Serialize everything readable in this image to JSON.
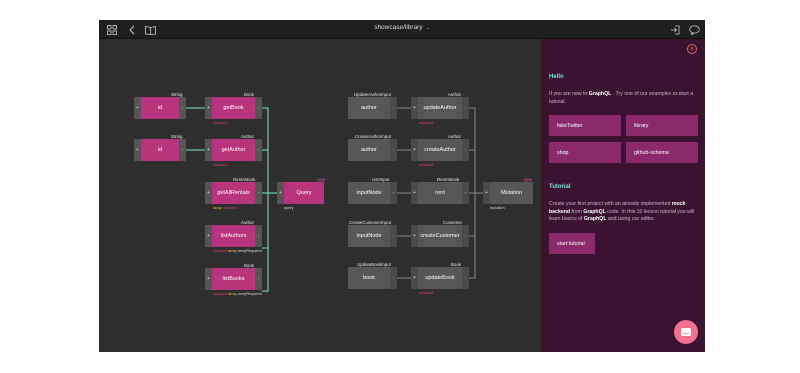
{
  "window": {
    "title": "showcase/library"
  },
  "toolbar": {
    "icons": [
      "grid-icon",
      "back-icon",
      "book-icon",
      "logout-icon",
      "chat-bubble-icon"
    ]
  },
  "graph": {
    "nodes": {
      "id1": {
        "label": "id",
        "type": "String"
      },
      "id2": {
        "label": "id",
        "type": "String"
      },
      "getBook": {
        "label": "getBook",
        "type": "Book",
        "sub": "required"
      },
      "getAuthor": {
        "label": "getAuthor",
        "type": "Author",
        "sub": "required"
      },
      "getAllRentals": {
        "label": "getAllRentals",
        "type": "RentABook",
        "sub_array": "array",
        "sub_required": "required"
      },
      "listAuthors": {
        "label": "listAuthors",
        "type": "Author",
        "sub_required": "required",
        "sub_array": "array",
        "sub_array_required": "arrayRequired"
      },
      "listBooks": {
        "label": "listBooks",
        "type": "Book",
        "sub_required": "required",
        "sub_array": "array",
        "sub_array_required": "arrayRequired"
      },
      "query": {
        "label": "Query",
        "type": "type",
        "sub": "query"
      },
      "author1": {
        "label": "author",
        "type": "UpdateAuthorInput"
      },
      "updateAuthor": {
        "label": "updateAuthor",
        "type": "Author",
        "sub": "required"
      },
      "author2": {
        "label": "author",
        "type": "CreateAuthorInput"
      },
      "createAuthor": {
        "label": "createAuthor",
        "type": "Author",
        "sub": "required"
      },
      "inputNode1": {
        "label": "inputNode",
        "type": "rentInput"
      },
      "rent": {
        "label": "rent",
        "type": "RentABook"
      },
      "mutation": {
        "label": "Mutation",
        "type": "type",
        "sub": "mutation"
      },
      "inputNode2": {
        "label": "inputNode",
        "type": "CreateCustomerInput"
      },
      "createCustomer": {
        "label": "createCustomer",
        "type": "Customer"
      },
      "book": {
        "label": "book",
        "type": "UpdateBookInput"
      },
      "updateBook": {
        "label": "updateBook",
        "type": "Book",
        "sub": "required"
      }
    },
    "handle_in": "+",
    "handle_out": "-"
  },
  "panel": {
    "hello_title": "Hello",
    "hello_text_1": "If you are new to ",
    "hello_text_bold": "GraphQL",
    "hello_text_2": " . Try one of our examples or start a tutorial.",
    "examples": [
      "fakeTwitter",
      "library",
      "shop",
      "github-schema"
    ],
    "tutorial_title": "Tutorial",
    "tutorial_text_1": "Create your first project with an already implemented ",
    "tutorial_bold_1": "mock backend",
    "tutorial_text_2": " from ",
    "tutorial_bold_2": "GraphQL",
    "tutorial_text_3": " code. In this 10 lesson tutorial you will learn basics of ",
    "tutorial_bold_3": "GraphQL",
    "tutorial_text_4": " and using our editor.",
    "start_tutorial": "start tutorial",
    "close_symbol": "×"
  },
  "colors": {
    "accent": "#b8357e",
    "panel_bg": "#3b1230",
    "wire": "#7fe6c8",
    "wire_gray": "#8a8a8a"
  }
}
